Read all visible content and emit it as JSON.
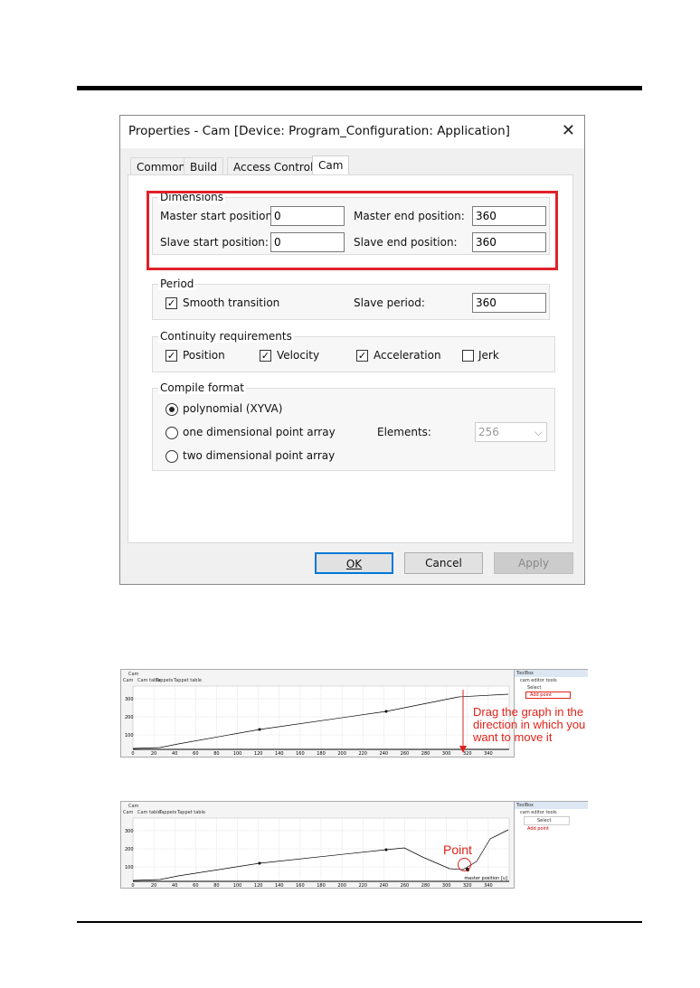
{
  "dialog": {
    "title": "Properties - Cam [Device: Program_Configuration: Application]",
    "tabs": [
      "Common",
      "Build",
      "Access Control",
      "Cam"
    ],
    "active_tab": "Cam",
    "dimensions": {
      "label": "Dimensions",
      "master_start_label": "Master start position:",
      "master_start": "0",
      "master_end_label": "Master end position:",
      "master_end": "360",
      "slave_start_label": "Slave start position:",
      "slave_start": "0",
      "slave_end_label": "Slave end position:",
      "slave_end": "360"
    },
    "period": {
      "label": "Period",
      "smooth_label": "Smooth transition",
      "smooth_checked": true,
      "slave_period_label": "Slave period:",
      "slave_period": "360"
    },
    "continuity": {
      "label": "Continuity requirements",
      "items": [
        {
          "label": "Position",
          "checked": true
        },
        {
          "label": "Velocity",
          "checked": true
        },
        {
          "label": "Acceleration",
          "checked": true
        },
        {
          "label": "Jerk",
          "checked": false
        }
      ]
    },
    "compile": {
      "label": "Compile format",
      "options": [
        "polynomial (XYVA)",
        "one dimensional point array",
        "two dimensional point array"
      ],
      "selected": "polynomial (XYVA)",
      "elements_label": "Elements:",
      "elements_value": "256"
    },
    "buttons": {
      "ok": "OK",
      "cancel": "Cancel",
      "apply": "Apply"
    },
    "highlight_color": "#e0202a"
  },
  "editor": {
    "doc_tab": "Cam",
    "view_tabs": [
      "Cam",
      "Cam table",
      "Tappets",
      "Tappet table"
    ],
    "x_ticks": [
      "0",
      "20",
      "40",
      "60",
      "80",
      "100",
      "120",
      "140",
      "160",
      "180",
      "200",
      "220",
      "240",
      "260",
      "280",
      "300",
      "320",
      "340"
    ],
    "y_ticks": [
      "300",
      "200",
      "100"
    ],
    "x_axis_label": "master position [u]",
    "toolbox": {
      "title": "ToolBox",
      "group": "cam editor tools",
      "items": [
        "Select",
        "Add point"
      ]
    }
  },
  "annotations": {
    "drag": "Drag the graph in the direction in which you want to move it",
    "point": "Point",
    "color": "#e2231a"
  }
}
